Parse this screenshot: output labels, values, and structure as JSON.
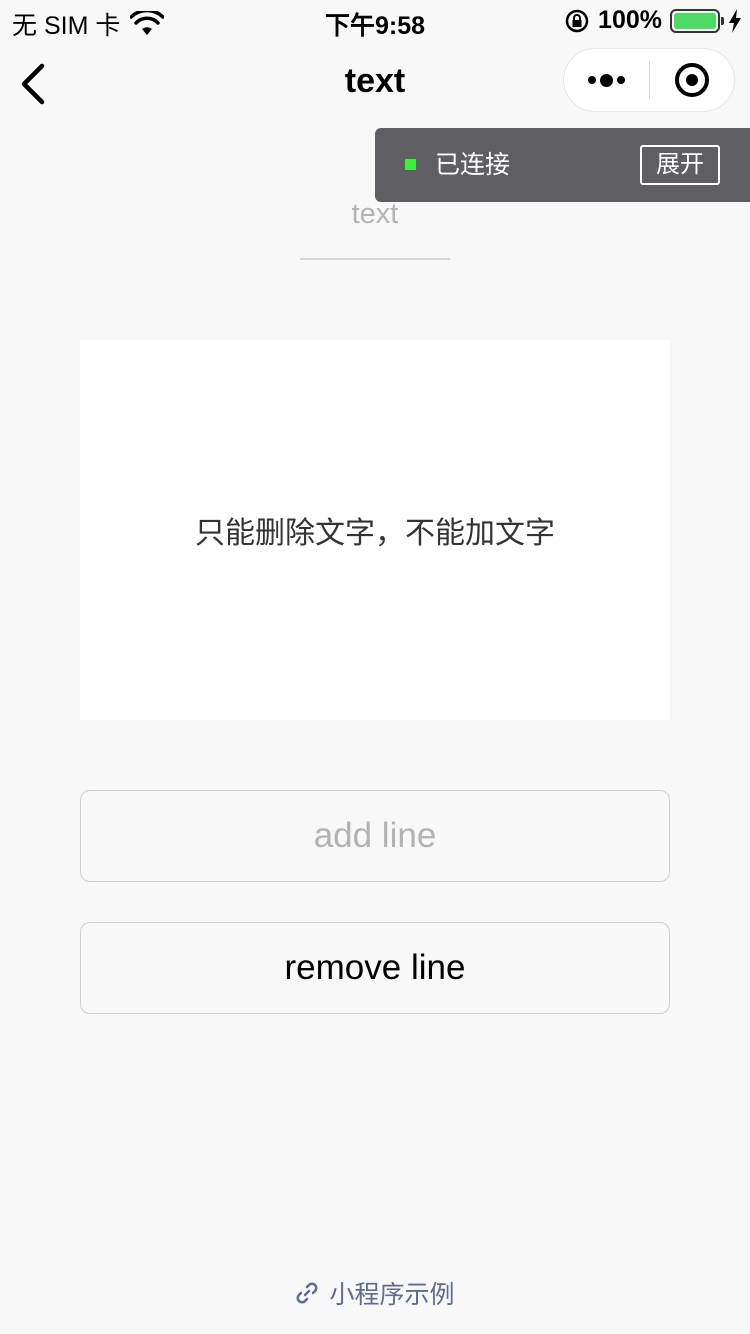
{
  "status_bar": {
    "carrier": "无 SIM 卡",
    "time": "下午9:58",
    "battery_percent": "100%",
    "battery_level": 1.0,
    "battery_color": "#4cd964"
  },
  "nav": {
    "title": "text",
    "back_icon": "chevron-left-icon",
    "more_icon": "more-dots-icon",
    "close_icon": "target-icon"
  },
  "connection": {
    "status_text": "已连接",
    "expand_label": "展开",
    "indicator_color": "#3bf03b"
  },
  "page": {
    "heading": "text",
    "content_text": "只能删除文字，不能加文字"
  },
  "buttons": {
    "add_line": "add line",
    "remove_line": "remove line"
  },
  "footer": {
    "label": "小程序示例",
    "icon": "link-icon"
  }
}
